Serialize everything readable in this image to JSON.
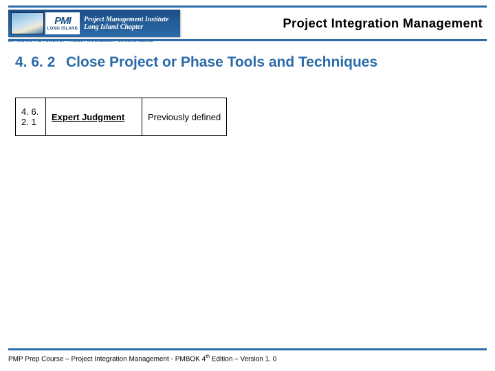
{
  "logo": {
    "pmi_big": "PMI",
    "pmi_small": "LONG ISLAND",
    "line1": "Project Management Institute",
    "line2": "Long Island Chapter",
    "tagline": "EXPANDING THE POWER OF PROJECT MANAGEMENT ON LONG ISLAND"
  },
  "header_title": "Project Integration Management",
  "section": {
    "number": "4. 6. 2",
    "title": "Close Project or Phase Tools and Techniques"
  },
  "rows": [
    {
      "num": "4. 6. 2. 1",
      "name": "Expert Judgment",
      "desc": "Previously defined"
    }
  ],
  "footer": {
    "pre": "PMP Prep Course – Project Integration Management - PMBOK 4",
    "sup": "th",
    "post": " Edition – Version 1. 0"
  }
}
